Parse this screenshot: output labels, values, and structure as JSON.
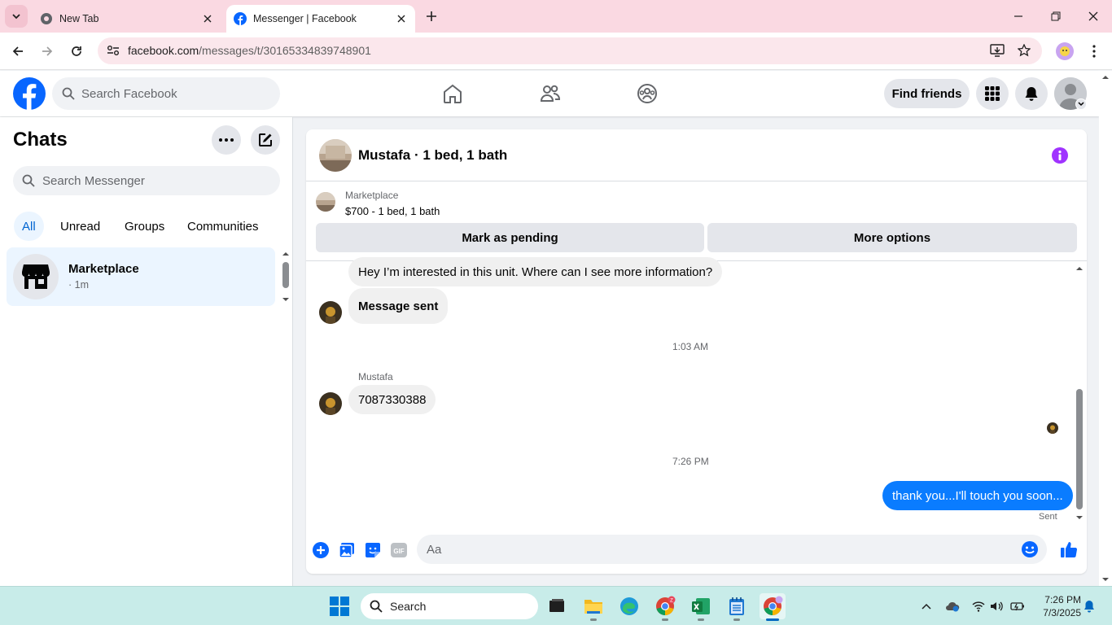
{
  "browser": {
    "tabs": [
      {
        "title": "New Tab",
        "active": false
      },
      {
        "title": "Messenger | Facebook",
        "active": true
      }
    ],
    "url_domain": "facebook.com",
    "url_path": "/messages/t/30165334839748901"
  },
  "header": {
    "search_placeholder": "Search Facebook",
    "find_friends_label": "Find friends",
    "brand_color": "#0866ff"
  },
  "sidebar": {
    "title": "Chats",
    "search_placeholder": "Search Messenger",
    "filters": [
      "All",
      "Unread",
      "Groups",
      "Communities"
    ],
    "chats": [
      {
        "name": "Marketplace",
        "time": "· 1m"
      }
    ]
  },
  "conversation": {
    "title": "Mustafa · 1 bed, 1 bath",
    "listing_source": "Marketplace",
    "listing_title": "$700 - 1 bed, 1 bath",
    "mark_pending_label": "Mark as pending",
    "more_options_label": "More options",
    "messages": [
      {
        "text": "Hey I’m interested in this unit.  Where can I see more information?",
        "from": "other"
      },
      {
        "text": "Message sent",
        "from": "other",
        "bold": true
      },
      {
        "timestamp": "1:03 AM"
      },
      {
        "sender": "Mustafa",
        "text": "7087330388",
        "from": "other"
      },
      {
        "timestamp": "7:26 PM"
      },
      {
        "text": "thank you...I'll touch you soon...",
        "from": "me",
        "status": "Sent"
      }
    ],
    "composer_placeholder": "Aa"
  },
  "taskbar": {
    "search_label": "Search",
    "time": "7:26 PM",
    "date": "7/3/2025",
    "apps": [
      "task-view",
      "file-explorer",
      "edge",
      "chrome-profile",
      "excel",
      "notepad",
      "chrome-active"
    ]
  }
}
